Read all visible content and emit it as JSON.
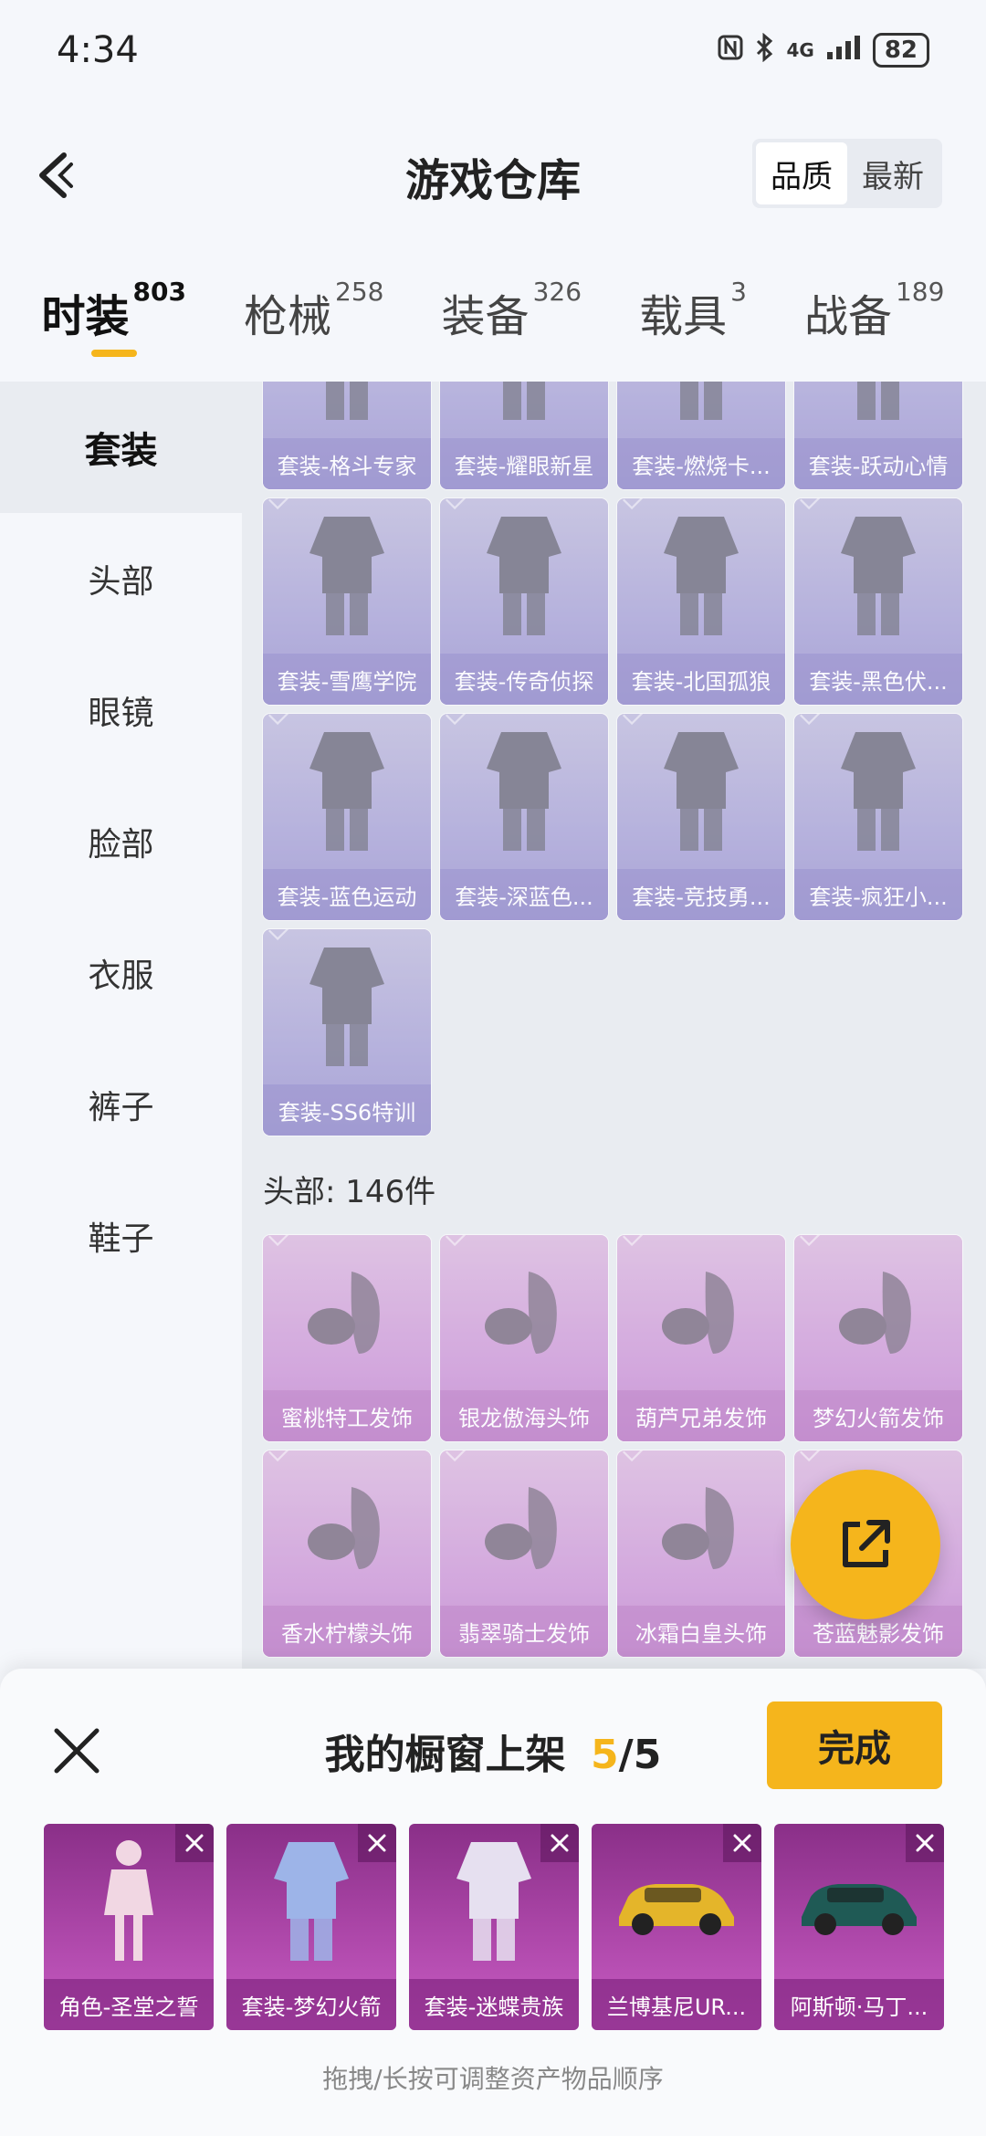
{
  "status_bar": {
    "time": "4:34",
    "network": "4G",
    "battery": "82"
  },
  "header": {
    "title": "游戏仓库",
    "sort_options": [
      {
        "label": "品质",
        "active": true
      },
      {
        "label": "最新",
        "active": false
      }
    ]
  },
  "category_tabs": [
    {
      "name": "时装",
      "count": "803",
      "active": true
    },
    {
      "name": "枪械",
      "count": "258",
      "active": false
    },
    {
      "name": "装备",
      "count": "326",
      "active": false
    },
    {
      "name": "载具",
      "count": "3",
      "active": false
    },
    {
      "name": "战备",
      "count": "189",
      "active": false
    }
  ],
  "sidebar": {
    "items": [
      {
        "label": "套装",
        "active": true
      },
      {
        "label": "头部",
        "active": false
      },
      {
        "label": "眼镜",
        "active": false
      },
      {
        "label": "脸部",
        "active": false
      },
      {
        "label": "衣服",
        "active": false
      },
      {
        "label": "裤子",
        "active": false
      },
      {
        "label": "鞋子",
        "active": false
      }
    ]
  },
  "suit_items": [
    {
      "label": "套装-格斗专家",
      "icon": "outfit-icon"
    },
    {
      "label": "套装-耀眼新星",
      "icon": "outfit-icon"
    },
    {
      "label": "套装-燃烧卡...",
      "icon": "outfit-icon"
    },
    {
      "label": "套装-跃动心情",
      "icon": "outfit-icon"
    },
    {
      "label": "套装-雪鹰学院",
      "icon": "outfit-icon"
    },
    {
      "label": "套装-传奇侦探",
      "icon": "outfit-icon"
    },
    {
      "label": "套装-北国孤狼",
      "icon": "outfit-icon"
    },
    {
      "label": "套装-黑色伏...",
      "icon": "outfit-icon"
    },
    {
      "label": "套装-蓝色运动",
      "icon": "outfit-icon"
    },
    {
      "label": "套装-深蓝色...",
      "icon": "outfit-icon"
    },
    {
      "label": "套装-竞技勇...",
      "icon": "outfit-icon"
    },
    {
      "label": "套装-疯狂小...",
      "icon": "outfit-icon"
    },
    {
      "label": "套装-SS6特训",
      "icon": "outfit-icon"
    }
  ],
  "head_section": {
    "title": "头部: 146件"
  },
  "head_items": [
    {
      "label": "蜜桃特工发饰",
      "icon": "hair-icon"
    },
    {
      "label": "银龙傲海头饰",
      "icon": "headwear-icon"
    },
    {
      "label": "葫芦兄弟发饰",
      "icon": "hair-icon"
    },
    {
      "label": "梦幻火箭发饰",
      "icon": "hair-icon"
    },
    {
      "label": "香水柠檬头饰",
      "icon": "headwear-icon"
    },
    {
      "label": "翡翠骑士发饰",
      "icon": "hair-icon"
    },
    {
      "label": "冰霜白皇头饰",
      "icon": "headwear-icon"
    },
    {
      "label": "苍蓝魅影发饰",
      "icon": "hair-icon"
    }
  ],
  "fab": {
    "icon": "share-icon"
  },
  "showcase": {
    "title": "我的橱窗上架",
    "current": "5",
    "separator": "/",
    "total": "5",
    "done_label": "完成",
    "items": [
      {
        "label": "角色-圣堂之誓",
        "icon": "character-icon"
      },
      {
        "label": "套装-梦幻火箭",
        "icon": "outfit-icon"
      },
      {
        "label": "套装-迷蝶贵族",
        "icon": "outfit-icon"
      },
      {
        "label": "兰博基尼UR...",
        "icon": "car-icon"
      },
      {
        "label": "阿斯顿·马丁...",
        "icon": "car-icon"
      }
    ],
    "hint": "拖拽/长按可调整资产物品顺序"
  },
  "colors": {
    "accent": "#f5b51c",
    "suit_card": "#9b95d0",
    "head_card": "#c68ad2",
    "showcase_card": "#b14aad"
  }
}
